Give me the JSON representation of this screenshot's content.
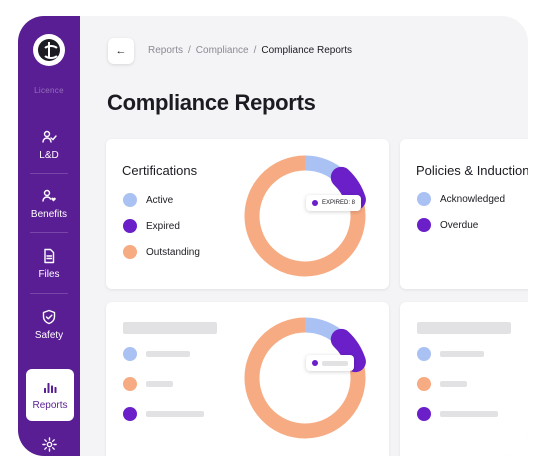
{
  "colors": {
    "sidebar": "#5a1e94",
    "active": "#a9c1f3",
    "expired": "#6a1fc9",
    "outstanding": "#f7ab83",
    "placeholder": "#e2e2e5"
  },
  "sidebar": {
    "faded_label": "Licence",
    "items": [
      {
        "label": "L&D",
        "icon": "learning-icon"
      },
      {
        "label": "Benefits",
        "icon": "benefits-icon"
      },
      {
        "label": "Files",
        "icon": "file-icon"
      },
      {
        "label": "Safety",
        "icon": "shield-icon"
      },
      {
        "label": "Reports",
        "icon": "bar-chart-icon",
        "active": true
      },
      {
        "label": "",
        "icon": "gear-icon"
      }
    ]
  },
  "header": {
    "back_icon": "←",
    "breadcrumb": [
      "Reports",
      "Compliance",
      "Compliance Reports"
    ],
    "separator": "/",
    "title": "Compliance Reports"
  },
  "certifications": {
    "title": "Certifications",
    "legend": [
      "Active",
      "Expired",
      "Outstanding"
    ],
    "tooltip": "EXPIRED: 8",
    "donut": {
      "active": 12,
      "expired": 8,
      "outstanding": 80
    }
  },
  "policies": {
    "title": "Policies & Inductions",
    "legend": [
      "Acknowledged",
      "Overdue"
    ]
  },
  "skeleton_card": {
    "donut": {
      "active": 12,
      "expired": 8,
      "outstanding": 80
    }
  }
}
